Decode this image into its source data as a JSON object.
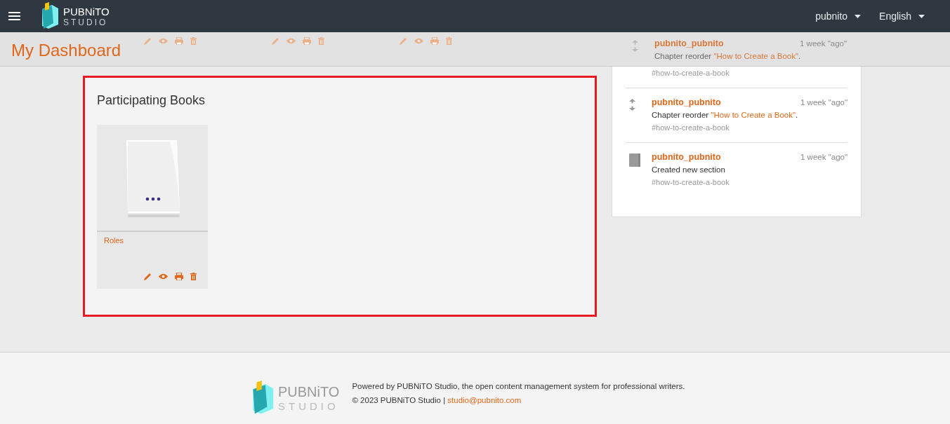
{
  "header": {
    "logo": {
      "name": "PUBNiTO",
      "subtitle": "STUDIO"
    },
    "user_menu": "pubnito",
    "language_menu": "English"
  },
  "page_title": "My Dashboard",
  "books_above": [
    {
      "kind": "book"
    },
    {
      "kind": "book"
    },
    {
      "kind": "book"
    }
  ],
  "participating_books": {
    "title": "Participating Books",
    "books": [
      {
        "title": "Roles"
      }
    ]
  },
  "activity": [
    {
      "kind": "reorder",
      "user": "pubnito_pubnito",
      "time": "1 week \"ago\"",
      "action": "Chapter reorder ",
      "link": "\"How to Create a Book\"",
      "after": ".",
      "tag": "#how-to-create-a-book"
    },
    {
      "kind": "reorder",
      "user": "pubnito_pubnito",
      "time": "1 week \"ago\"",
      "action": "Chapter reorder ",
      "link": "\"How to Create a Book\"",
      "after": ".",
      "tag": "#how-to-create-a-book"
    },
    {
      "kind": "section",
      "user": "pubnito_pubnito",
      "time": "1 week \"ago\"",
      "action": "Created new section",
      "tag": "#how-to-create-a-book"
    }
  ],
  "footer": {
    "logo": {
      "name": "PUBNiTO",
      "subtitle": "STUDIO"
    },
    "powered_by": "Powered by PUBNiTO Studio, the open content management system for professional writers.",
    "copyright": "© 2023 PUBNiTO Studio | ",
    "email": "studio@pubnito.com"
  }
}
